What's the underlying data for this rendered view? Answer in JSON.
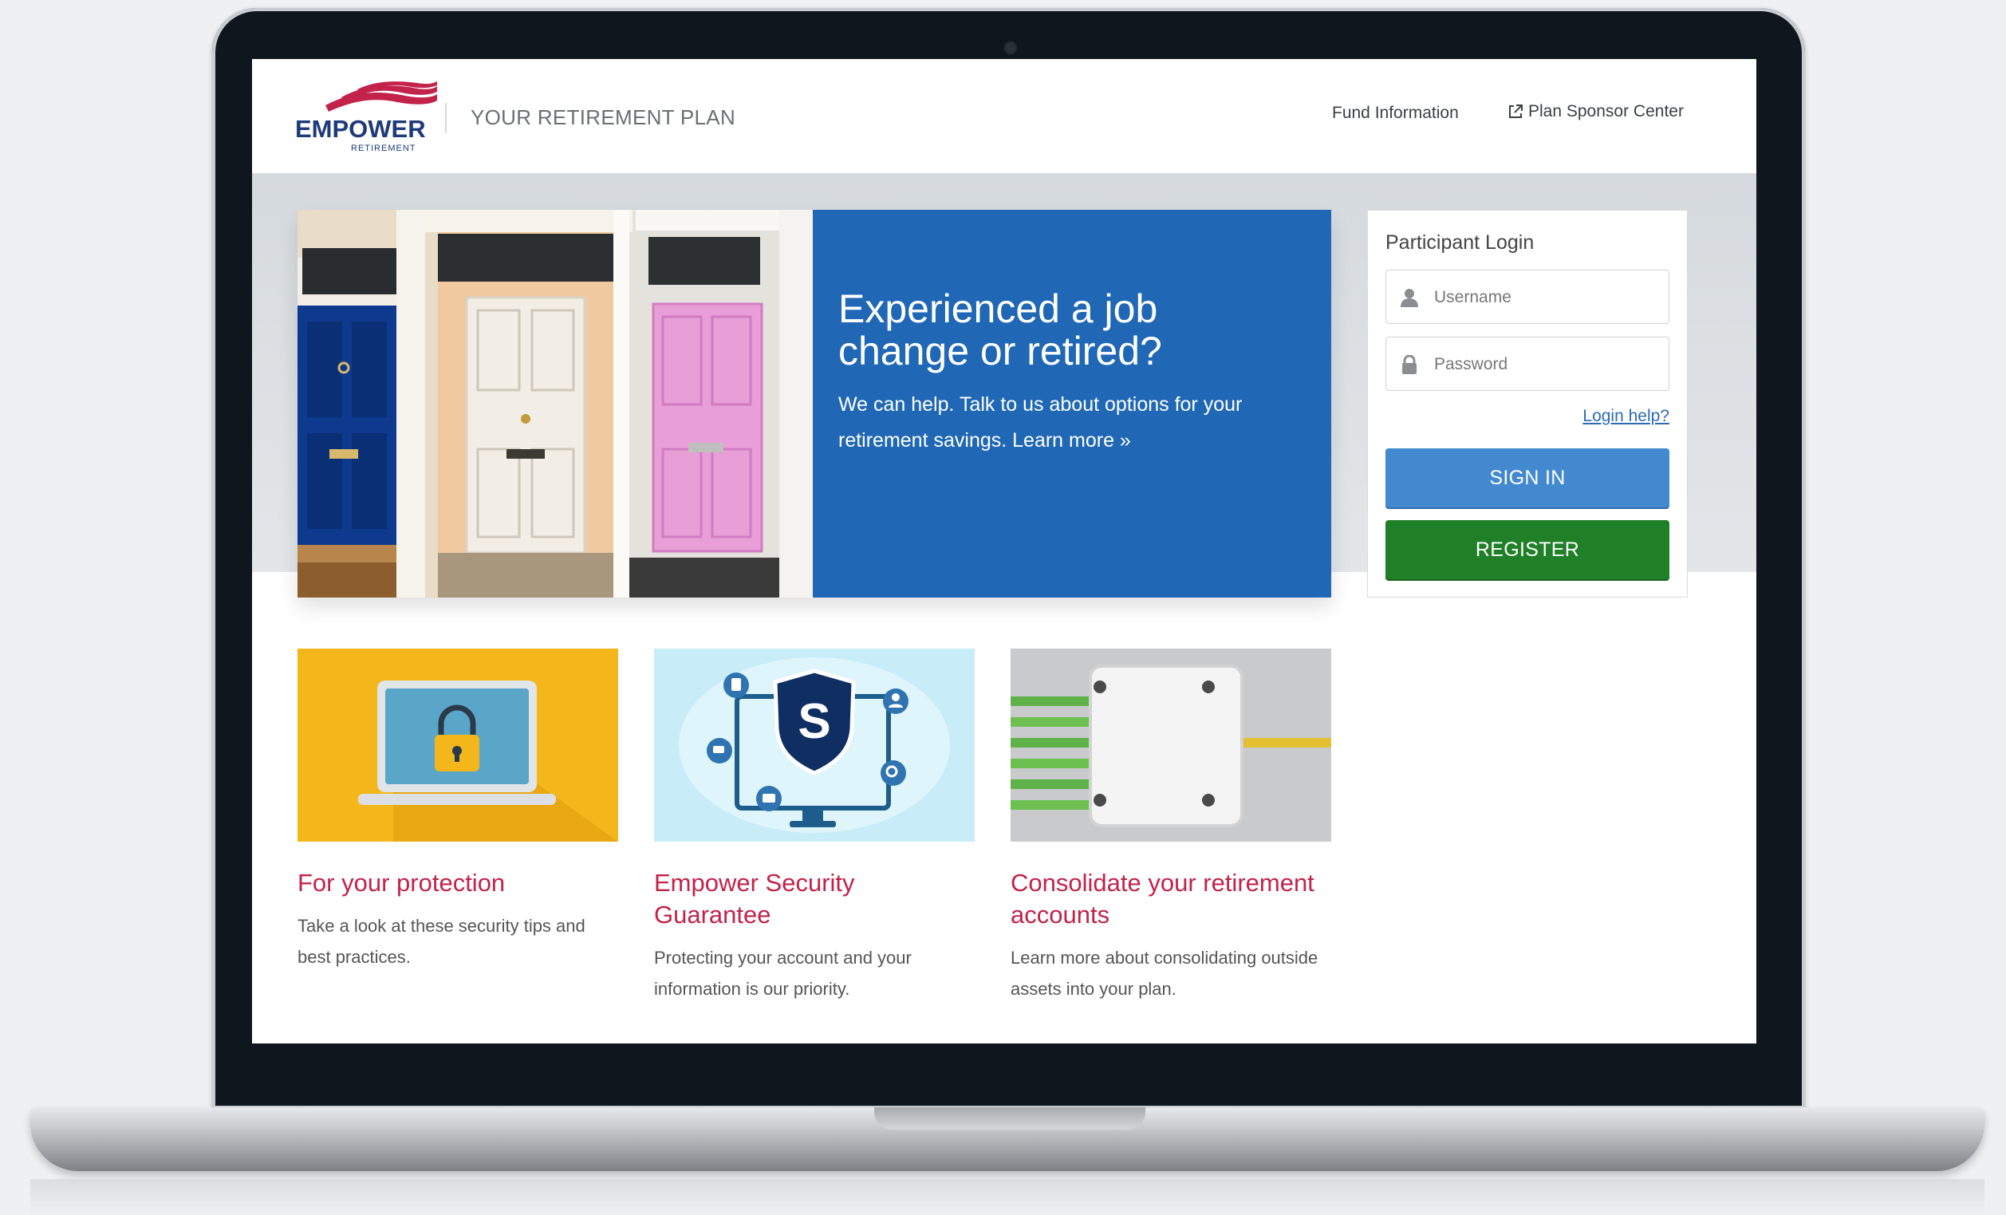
{
  "header": {
    "logo_word": "EMPOWER",
    "logo_sub": "RETIREMENT",
    "plan_title": "YOUR RETIREMENT PLAN",
    "nav_fund": "Fund Information",
    "nav_sponsor": "Plan Sponsor Center"
  },
  "hero": {
    "title": "Experienced a job change or retired?",
    "text": "We can help. Talk to us about options for your retirement savings. Learn more »"
  },
  "login": {
    "title": "Participant Login",
    "username_placeholder": "Username",
    "password_placeholder": "Password",
    "help_link": "Login help?",
    "signin_label": "SIGN IN",
    "register_label": "REGISTER"
  },
  "cards": [
    {
      "title": "For your protection",
      "text": "Take a look at these security tips and best practices."
    },
    {
      "title": "Empower Security Guarantee",
      "text": "Protecting your account and your information is our priority."
    },
    {
      "title": "Consolidate your retirement accounts",
      "text": "Learn more about consolidating outside assets into your plan."
    }
  ],
  "colors": {
    "brand_navy": "#1f3a7a",
    "brand_red": "#c3224a",
    "hero_blue": "#2068b5",
    "signin_blue": "#4389d0",
    "register_green": "#208028"
  }
}
